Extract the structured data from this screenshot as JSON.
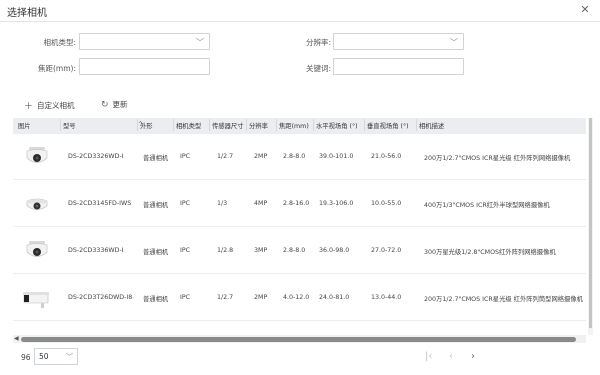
{
  "dialog": {
    "title": "选择相机",
    "close_icon": "close-icon"
  },
  "filters": {
    "camera_type_label": "相机类型:",
    "camera_type_value": "",
    "resolution_label": "分辨率:",
    "resolution_value": "",
    "focal_label": "焦距(mm):",
    "focal_value": "",
    "keyword_label": "关键词:",
    "keyword_value": ""
  },
  "toolbar": {
    "add_label": "自定义相机",
    "refresh_label": "更新"
  },
  "table": {
    "headers": {
      "image": "图片",
      "model": "型号",
      "shape": "外形",
      "camera_type": "相机类型",
      "sensor": "传感器尺寸",
      "resolution": "分辨率",
      "focal": "焦距(mm)",
      "hfov": "水平视场角 (°)",
      "vfov": "垂直视场角 (°)",
      "desc": "相机描述"
    },
    "rows": [
      {
        "model": "DS-2CD3326WD-I",
        "shape": "普通相机",
        "camera_type": "IPC",
        "sensor": "1/2.7",
        "resolution": "2MP",
        "focal": "2.8-8.0",
        "hfov": "39.0-101.0",
        "vfov": "21.0-56.0",
        "desc": "200万1/2.7\"CMOS ICR星光级 红外阵列网络摄像机",
        "icon": "dome-camera-icon"
      },
      {
        "model": "DS-2CD3145FD-IWS",
        "shape": "普通相机",
        "camera_type": "IPC",
        "sensor": "1/3",
        "resolution": "4MP",
        "focal": "2.8-16.0",
        "hfov": "19.3-106.0",
        "vfov": "10.0-55.0",
        "desc": "400万1/3\"CMOS ICR红外半球型网络摄像机",
        "icon": "dome-camera-icon"
      },
      {
        "model": "DS-2CD3336WD-I",
        "shape": "普通相机",
        "camera_type": "IPC",
        "sensor": "1/2.8",
        "resolution": "3MP",
        "focal": "2.8-8.0",
        "hfov": "36.0-98.0",
        "vfov": "27.0-72.0",
        "desc": "300万星光级1/2.8\"CMOS红外阵列网络摄像机",
        "icon": "dome-camera-icon"
      },
      {
        "model": "DS-2CD3T26DWD-I8",
        "shape": "普通相机",
        "camera_type": "IPC",
        "sensor": "1/2.7",
        "resolution": "2MP",
        "focal": "4.0-12.0",
        "hfov": "24.0-81.0",
        "vfov": "13.0-44.0",
        "desc": "200万1/2.7\"CMOS ICR星光级 红外阵列筒型网络摄像机",
        "icon": "bullet-camera-icon"
      }
    ]
  },
  "footer": {
    "total": "96",
    "page_size": "50"
  }
}
